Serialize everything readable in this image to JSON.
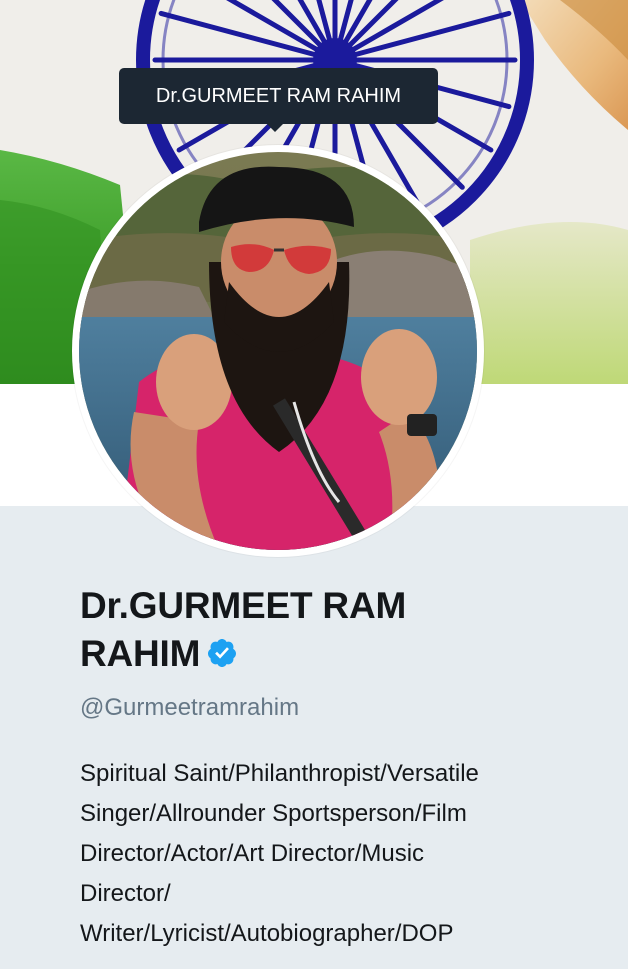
{
  "tooltip": {
    "text": "Dr.GURMEET RAM RAHIM"
  },
  "profile": {
    "name_line1": "Dr.GURMEET RAM",
    "name_line2": "RAHIM",
    "verified_icon": "verified-badge-icon",
    "handle": "@Gurmeetramrahim",
    "bio_lines": [
      "Spiritual Saint/Philanthropist/Versatile",
      "Singer/Allrounder Sportsperson/Film",
      "Director/Actor/Art Director/Music",
      "Director/",
      "Writer/Lyricist/Autobiographer/DOP"
    ]
  },
  "colors": {
    "tooltip_bg": "#1c2733",
    "verified_blue": "#1da1f2",
    "handle_gray": "#657786",
    "text_dark": "#14171a",
    "page_bg": "#e6ecf0",
    "chakra_blue": "#1b1a9c",
    "flag_green": "#3fa12a",
    "flag_saffron": "#e8a34a"
  }
}
